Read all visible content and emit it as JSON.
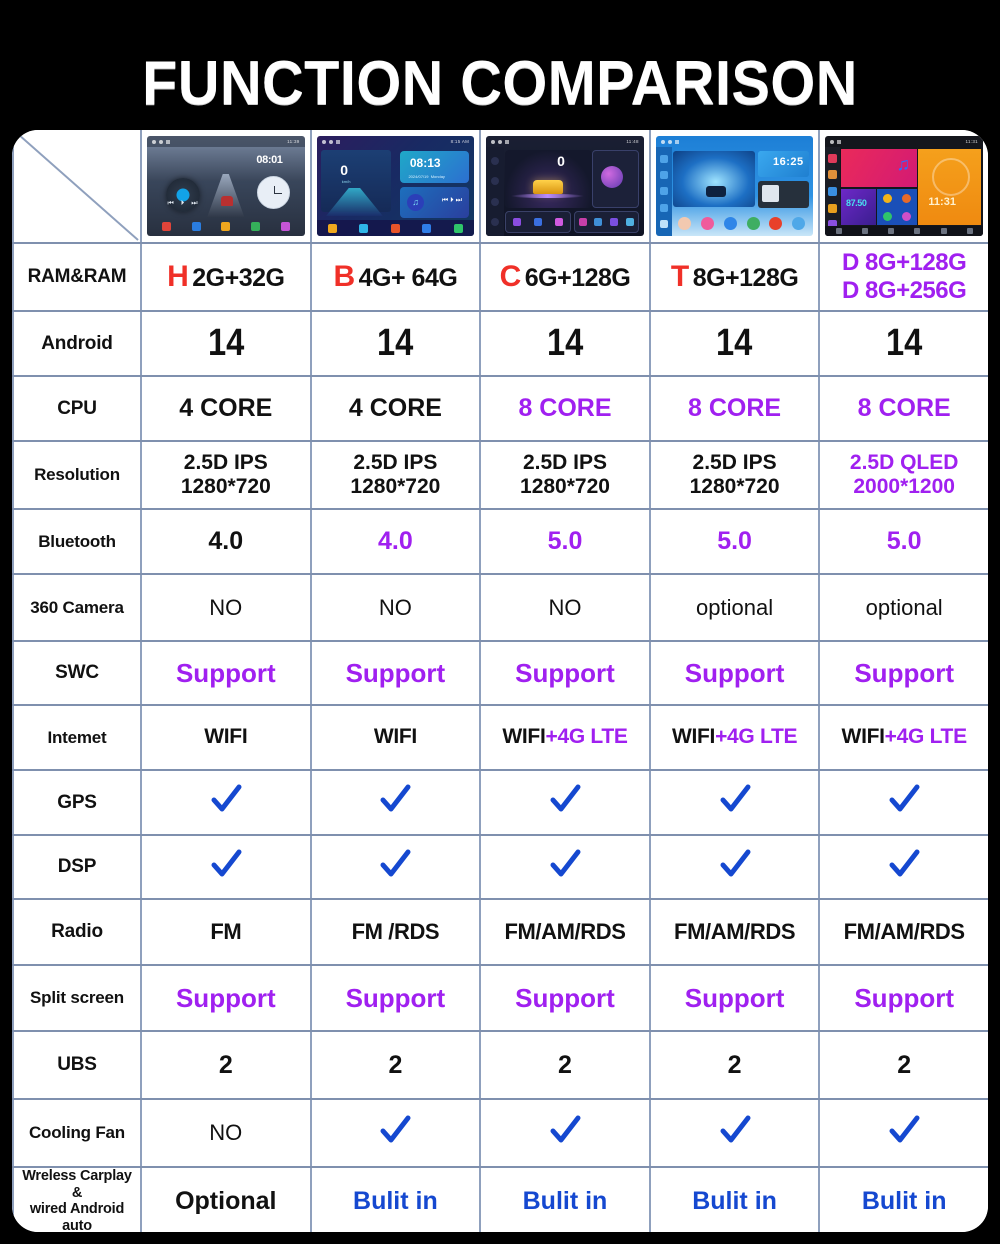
{
  "title": "FUNCTION COMPARISON",
  "colors": {
    "purple": "#a020f0",
    "red": "#f03028",
    "blue": "#1548d0",
    "black": "#111111",
    "title": "#ffffff",
    "background": "#000000"
  },
  "table": {
    "corner_label": "",
    "columns": [
      {
        "id": "h",
        "badge": "H",
        "ram": "2G+32G",
        "thumb": "car-stereo-ui-dark-blue"
      },
      {
        "id": "b",
        "badge": "B",
        "ram": "4G+ 64G",
        "thumb": "car-stereo-ui-purple-teal"
      },
      {
        "id": "c",
        "badge": "C",
        "ram": "6G+128G",
        "thumb": "car-stereo-ui-yellow-car"
      },
      {
        "id": "t",
        "badge": "T",
        "ram": "8G+128G",
        "thumb": "car-stereo-ui-light-blue"
      },
      {
        "id": "d",
        "badge": "",
        "ram_line1": "D 8G+128G",
        "ram_line2": "D 8G+256G",
        "thumb": "car-stereo-ui-tiles"
      }
    ],
    "rows": [
      {
        "label": "RAM&RAM",
        "type": "ram"
      },
      {
        "label": "Android",
        "type": "android",
        "values": [
          {
            "text": "14",
            "color": "black"
          },
          {
            "text": "14",
            "color": "black"
          },
          {
            "text": "14",
            "color": "black"
          },
          {
            "text": "14",
            "color": "black"
          },
          {
            "text": "14",
            "color": "black"
          }
        ]
      },
      {
        "label": "CPU",
        "type": "core",
        "values": [
          {
            "text": "4 CORE",
            "color": "black"
          },
          {
            "text": "4 CORE",
            "color": "black"
          },
          {
            "text": "8 CORE",
            "color": "purple"
          },
          {
            "text": "8 CORE",
            "color": "purple"
          },
          {
            "text": "8 CORE",
            "color": "purple"
          }
        ]
      },
      {
        "label": "Resolution",
        "type": "res",
        "values": [
          {
            "line1": "2.5D IPS",
            "line2": "1280*720",
            "color": "black"
          },
          {
            "line1": "2.5D IPS",
            "line2": "1280*720",
            "color": "black"
          },
          {
            "line1": "2.5D IPS",
            "line2": "1280*720",
            "color": "black"
          },
          {
            "line1": "2.5D IPS",
            "line2": "1280*720",
            "color": "black"
          },
          {
            "line1": "2.5D QLED",
            "line2": "2000*1200",
            "color": "purple"
          }
        ]
      },
      {
        "label": "Bluetooth",
        "type": "bt",
        "values": [
          {
            "text": "4.0",
            "color": "black"
          },
          {
            "text": "4.0",
            "color": "purple"
          },
          {
            "text": "5.0",
            "color": "purple"
          },
          {
            "text": "5.0",
            "color": "purple"
          },
          {
            "text": "5.0",
            "color": "purple"
          }
        ]
      },
      {
        "label": "360 Camera",
        "type": "cam",
        "values": [
          {
            "text": "NO",
            "color": "black"
          },
          {
            "text": "NO",
            "color": "black"
          },
          {
            "text": "NO",
            "color": "black"
          },
          {
            "text": "optional",
            "color": "black"
          },
          {
            "text": "optional",
            "color": "black"
          }
        ]
      },
      {
        "label": "SWC",
        "type": "swc",
        "values": [
          {
            "text": "Support",
            "color": "purple"
          },
          {
            "text": "Support",
            "color": "purple"
          },
          {
            "text": "Support",
            "color": "purple"
          },
          {
            "text": "Support",
            "color": "purple"
          },
          {
            "text": "Support",
            "color": "purple"
          }
        ]
      },
      {
        "label": "Intemet",
        "type": "net",
        "values": [
          {
            "wifi": "WIFI",
            "lte": "",
            "color": "black"
          },
          {
            "wifi": "WIFI",
            "lte": "",
            "color": "black"
          },
          {
            "wifi": "WIFI",
            "lte": "+4G LTE",
            "color": "black"
          },
          {
            "wifi": "WIFI",
            "lte": "+4G LTE",
            "color": "black"
          },
          {
            "wifi": "WIFI",
            "lte": "+4G LTE",
            "color": "black"
          }
        ]
      },
      {
        "label": "GPS",
        "type": "check",
        "values": [
          {
            "check": true
          },
          {
            "check": true
          },
          {
            "check": true
          },
          {
            "check": true
          },
          {
            "check": true
          }
        ]
      },
      {
        "label": "DSP",
        "type": "check",
        "values": [
          {
            "check": true
          },
          {
            "check": true
          },
          {
            "check": true
          },
          {
            "check": true
          },
          {
            "check": true
          }
        ]
      },
      {
        "label": "Radio",
        "type": "radio",
        "values": [
          {
            "text": "FM",
            "color": "black"
          },
          {
            "text": "FM /RDS",
            "color": "black"
          },
          {
            "text": "FM/AM/RDS",
            "color": "black"
          },
          {
            "text": "FM/AM/RDS",
            "color": "black"
          },
          {
            "text": "FM/AM/RDS",
            "color": "black"
          }
        ]
      },
      {
        "label": "Split screen",
        "type": "swc",
        "values": [
          {
            "text": "Support",
            "color": "purple"
          },
          {
            "text": "Support",
            "color": "purple"
          },
          {
            "text": "Support",
            "color": "purple"
          },
          {
            "text": "Support",
            "color": "purple"
          },
          {
            "text": "Support",
            "color": "purple"
          }
        ]
      },
      {
        "label": "UBS",
        "type": "usb",
        "values": [
          {
            "text": "2",
            "color": "black"
          },
          {
            "text": "2",
            "color": "black"
          },
          {
            "text": "2",
            "color": "black"
          },
          {
            "text": "2",
            "color": "black"
          },
          {
            "text": "2",
            "color": "black"
          }
        ]
      },
      {
        "label": "Cooling Fan",
        "type": "fan",
        "values": [
          {
            "text": "NO",
            "color": "black"
          },
          {
            "check": true
          },
          {
            "check": true
          },
          {
            "check": true
          },
          {
            "check": true
          }
        ]
      },
      {
        "label": "Wreless Carplay\n&\nwired Android\nauto",
        "label_line1": "Wreless Carplay",
        "label_line2": "&",
        "label_line3": "wired Android",
        "label_line4": "auto",
        "type": "carplay",
        "values": [
          {
            "text": "Optional",
            "color": "black"
          },
          {
            "text": "Bulit in",
            "color": "blue"
          },
          {
            "text": "Bulit in",
            "color": "blue"
          },
          {
            "text": "Bulit in",
            "color": "blue"
          },
          {
            "text": "Bulit in",
            "color": "blue"
          }
        ]
      }
    ]
  },
  "thumbnails": [
    {
      "time": "08:01",
      "speed": "",
      "theme": "dark-blue-road"
    },
    {
      "time": "08:13",
      "speed": "0",
      "theme": "purple-teal-city",
      "unit": "km/h"
    },
    {
      "time": "",
      "speed": "0",
      "theme": "navy-yellow-car"
    },
    {
      "time": "16:25",
      "speed": "",
      "theme": "blue-hero-car"
    },
    {
      "time": "11:31",
      "freq": "87.50",
      "theme": "color-tiles"
    }
  ]
}
